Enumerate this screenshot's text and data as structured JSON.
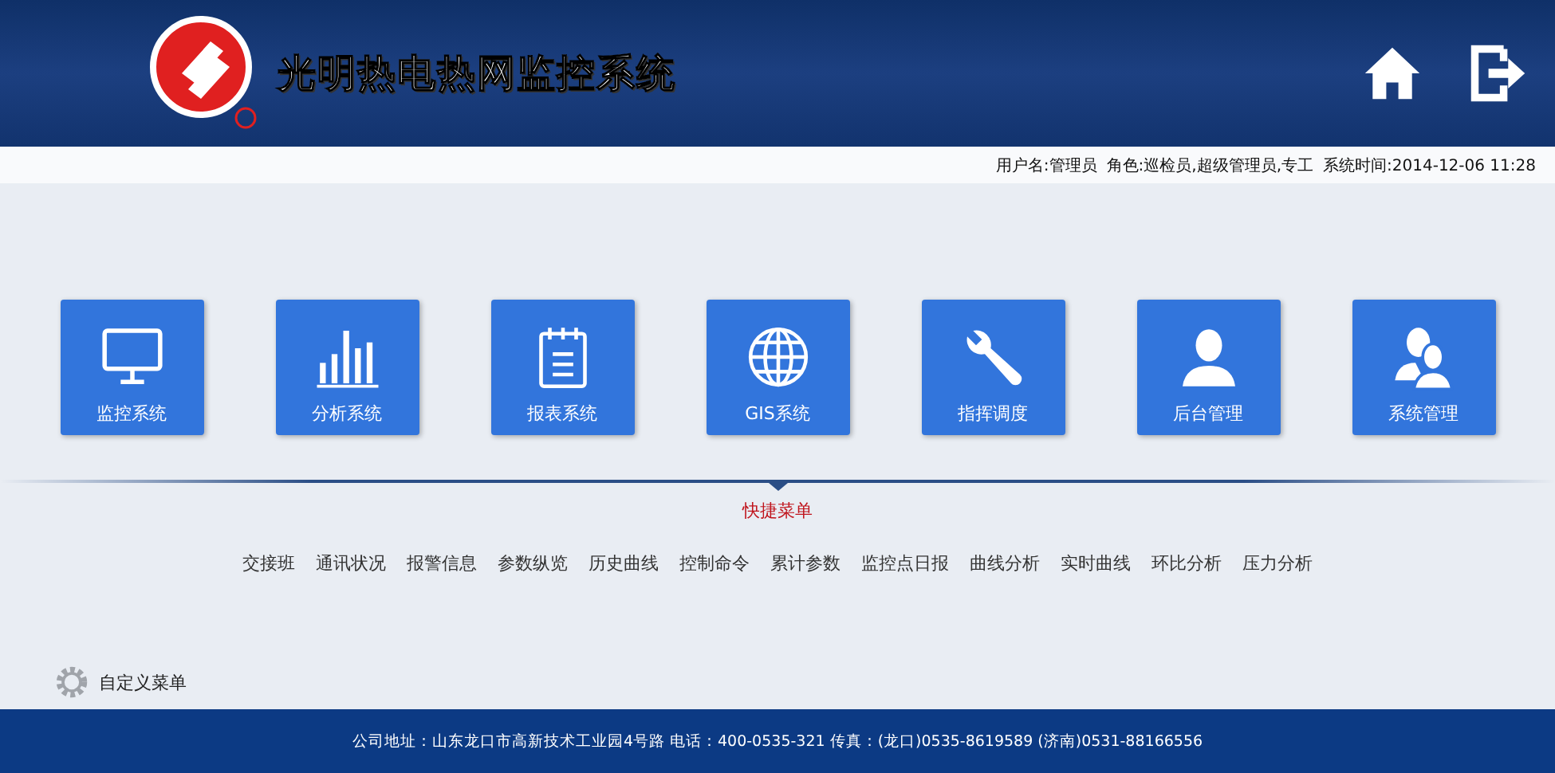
{
  "header": {
    "title": "光明热电热网监控系统"
  },
  "info_bar": {
    "user": "用户名:管理员",
    "role": "角色:巡检员,超级管理员,专工",
    "time": "系统时间:2014-12-06 11:28"
  },
  "tiles": [
    {
      "label": "监控系统"
    },
    {
      "label": "分析系统"
    },
    {
      "label": "报表系统"
    },
    {
      "label": "GIS系统"
    },
    {
      "label": "指挥调度"
    },
    {
      "label": "后台管理"
    },
    {
      "label": "系统管理"
    }
  ],
  "quick_menu": {
    "title": "快捷菜单",
    "links": [
      "交接班",
      "通讯状况",
      "报警信息",
      "参数纵览",
      "历史曲线",
      "控制命令",
      "累计参数",
      "监控点日报",
      "曲线分析",
      "实时曲线",
      "环比分析",
      "压力分析"
    ]
  },
  "custom_menu": {
    "label": "自定义菜单"
  },
  "footer": {
    "address": "公司地址：山东龙口市高新技术工业园4号路 电话：400-0535-321 传真：(龙口)0535-8619589 (济南)0531-88166556"
  }
}
